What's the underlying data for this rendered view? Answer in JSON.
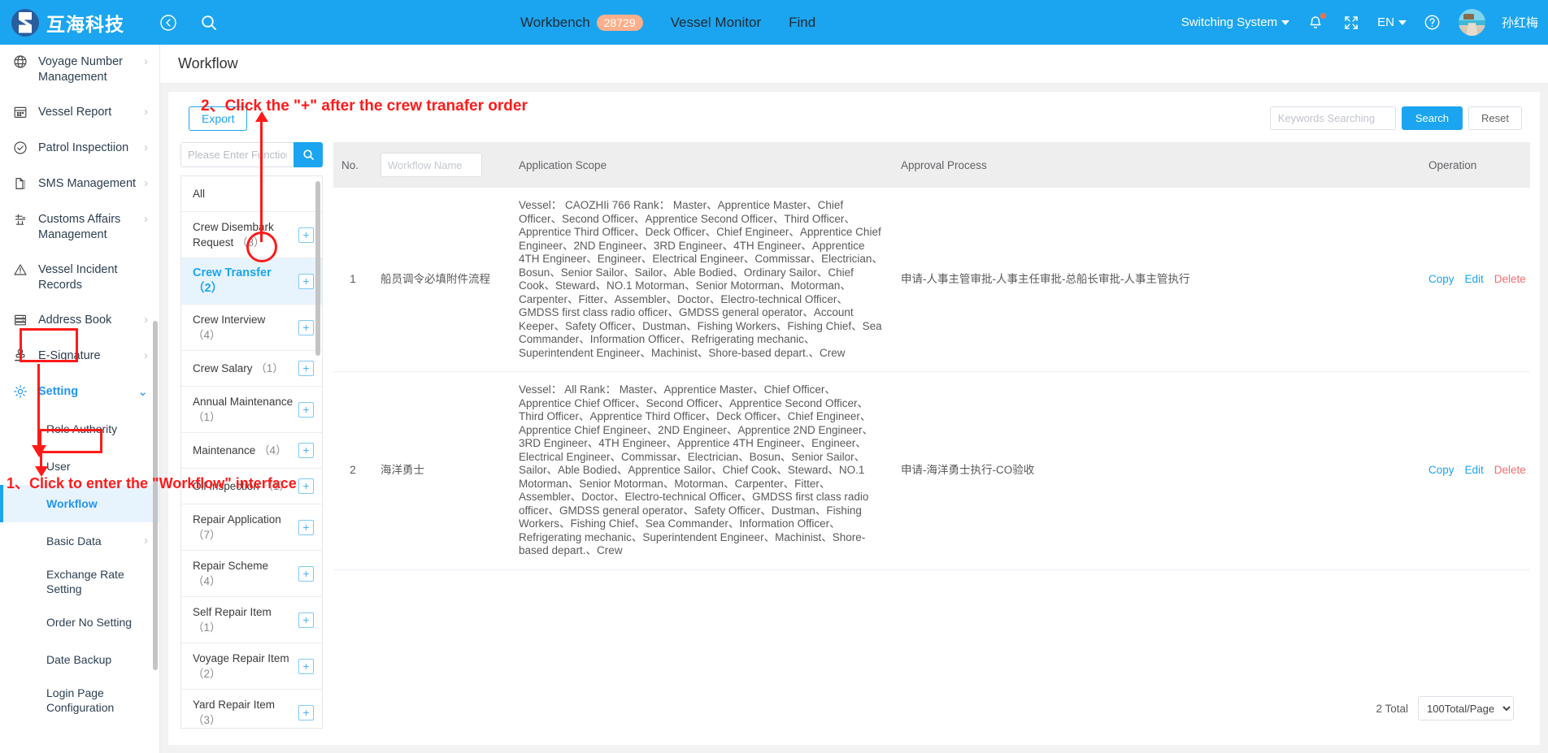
{
  "header": {
    "brand": "互海科技",
    "back_icon": "back-arrow-icon",
    "search_icon": "search-icon",
    "nav": [
      {
        "label": "Workbench",
        "badge": "28729"
      },
      {
        "label": "Vessel Monitor",
        "badge": ""
      },
      {
        "label": "Find",
        "badge": ""
      }
    ],
    "switching_system": "Switching System",
    "language": "EN",
    "user_name": "孙红梅"
  },
  "sidebar": {
    "items": [
      {
        "label": "Voyage Number Management",
        "icon": "globe-icon",
        "arrow": "›"
      },
      {
        "label": "Vessel Report",
        "icon": "calendar-icon",
        "arrow": "›"
      },
      {
        "label": "Patrol Inspectiion",
        "icon": "check-circle-icon",
        "arrow": "›"
      },
      {
        "label": "SMS Management",
        "icon": "documents-icon",
        "arrow": "›"
      },
      {
        "label": "Customs Affairs Management",
        "icon": "customs-icon",
        "arrow": "›"
      },
      {
        "label": "Vessel Incident Records",
        "icon": "warning-triangle-icon",
        "arrow": ""
      },
      {
        "label": "Address Book",
        "icon": "address-book-icon",
        "arrow": "›"
      },
      {
        "label": "E-Signature",
        "icon": "stamp-icon",
        "arrow": "›"
      },
      {
        "label": "Setting",
        "icon": "gear-icon",
        "arrow": "⌄"
      }
    ],
    "sub_items": [
      {
        "label": "Role Authority",
        "arrow": ""
      },
      {
        "label": "User",
        "arrow": ""
      },
      {
        "label": "Workflow",
        "arrow": ""
      },
      {
        "label": "Basic Data",
        "arrow": "›"
      },
      {
        "label": "Exchange Rate Setting",
        "arrow": ""
      },
      {
        "label": "Order No Setting",
        "arrow": ""
      },
      {
        "label": "Date Backup",
        "arrow": ""
      },
      {
        "label": "Login Page Configuration",
        "arrow": ""
      }
    ]
  },
  "page": {
    "title": "Workflow"
  },
  "toolbar": {
    "export_label": "Export",
    "keywords_placeholder": "Keywords Searching",
    "keywords_value": "",
    "search_label": "Search",
    "reset_label": "Reset"
  },
  "function_panel": {
    "search_placeholder": "Please Enter Function Name",
    "search_value": "",
    "search_icon": "search-icon",
    "items": [
      {
        "name": "All",
        "count": "",
        "plus": false
      },
      {
        "name": "Crew Disembark Request",
        "count": "（8）",
        "plus": true
      },
      {
        "name": "Crew Transfer",
        "count": "（2）",
        "plus": true
      },
      {
        "name": "Crew Interview",
        "count": "（4）",
        "plus": true
      },
      {
        "name": "Crew Salary",
        "count": "（1）",
        "plus": true
      },
      {
        "name": "Annual Maintenance",
        "count": "（1）",
        "plus": true
      },
      {
        "name": "Maintenance",
        "count": "（4）",
        "plus": true
      },
      {
        "name": "Oil Inspection",
        "count": "（1）",
        "plus": true
      },
      {
        "name": "Repair Application",
        "count": "（7）",
        "plus": true
      },
      {
        "name": "Repair Scheme",
        "count": "（4）",
        "plus": true
      },
      {
        "name": "Self Repair Item",
        "count": "（1）",
        "plus": true
      },
      {
        "name": "Voyage Repair Item",
        "count": "（2）",
        "plus": true
      },
      {
        "name": "Yard Repair Item",
        "count": "（3）",
        "plus": true
      }
    ],
    "active_index": 2
  },
  "table": {
    "headers": {
      "no": "No.",
      "workflow_name": "Workflow Name",
      "workflow_name_placeholder": "Workflow Name",
      "workflow_name_value": "",
      "application_scope": "Application Scope",
      "approval_process": "Approval Process",
      "operation": "Operation"
    },
    "rows": [
      {
        "no": "1",
        "name": "船员调令必填附件流程",
        "scope": "Vessel： CAOZHIi 766\nRank： Master、Apprentice Master、Chief Officer、Second Officer、Apprentice Second Officer、Third Officer、Apprentice Third Officer、Deck Officer、Chief Engineer、Apprentice Chief Engineer、2ND Engineer、3RD Engineer、4TH Engineer、Apprentice 4TH Engineer、Engineer、Electrical Engineer、Commissar、Electrician、Bosun、Senior Sailor、Sailor、Able Bodied、Ordinary Sailor、Chief Cook、Steward、NO.1 Motorman、Senior Motorman、Motorman、Carpenter、Fitter、Assembler、Doctor、Electro-technical Officer、GMDSS first class radio officer、GMDSS general operator、Account Keeper、Safety Officer、Dustman、Fishing Workers、Fishing Chief、Sea Commander、Information Officer、Refrigerating mechanic、Superintendent Engineer、Machinist、Shore-based depart.、Crew",
        "approval": "申请-人事主管审批-人事主任审批-总船长审批-人事主管执行",
        "ops": [
          {
            "label": "Copy",
            "kind": "link"
          },
          {
            "label": "Edit",
            "kind": "link"
          },
          {
            "label": "Delete",
            "kind": "danger"
          }
        ]
      },
      {
        "no": "2",
        "name": "海洋勇士",
        "scope": "Vessel： All\nRank： Master、Apprentice Master、Chief Officer、Apprentice Chief Officer、Second Officer、Apprentice Second Officer、Third Officer、Apprentice Third Officer、Deck Officer、Chief Engineer、Apprentice Chief Engineer、2ND Engineer、Apprentice 2ND Engineer、3RD Engineer、4TH Engineer、Apprentice 4TH Engineer、Engineer、Electrical Engineer、Commissar、Electrician、Bosun、Senior Sailor、Sailor、Able Bodied、Apprentice Sailor、Chief Cook、Steward、NO.1 Motorman、Senior Motorman、Motorman、Carpenter、Fitter、Assembler、Doctor、Electro-technical Officer、GMDSS first class radio officer、GMDSS general operator、Safety Officer、Dustman、Fishing Workers、Fishing Chief、Sea Commander、Information Officer、Refrigerating mechanic、Superintendent Engineer、Machinist、Shore-based depart.、Crew",
        "approval": "申请-海洋勇士执行-CO验收",
        "ops": [
          {
            "label": "Copy",
            "kind": "link"
          },
          {
            "label": "Edit",
            "kind": "link"
          },
          {
            "label": "Delete",
            "kind": "danger"
          }
        ]
      }
    ],
    "pagination": {
      "total_text": "2 Total",
      "page_size": "100Total/Page"
    }
  },
  "annotations": {
    "step1": "1、Click to enter the \"Workflow\" interface",
    "step2": "2、Click the \"+\" after the crew tranafer order",
    "color": "#FF1A1A"
  }
}
